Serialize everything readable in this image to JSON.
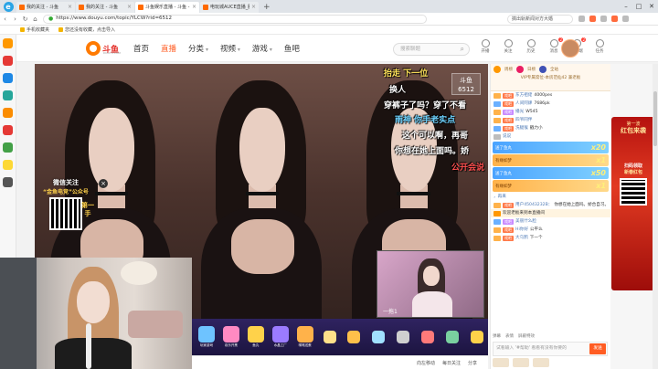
{
  "browser": {
    "tabs": [
      {
        "label": "我的关注 - 斗鱼"
      },
      {
        "label": "我的关注 - 斗鱼"
      },
      {
        "label": "斗鱼娱乐直播 - 斗鱼 - 每个人的直播平台"
      },
      {
        "label": "电玩城AUCE直播_腾讯直播 - 斗鱼"
      }
    ],
    "url": "https://www.douyu.com/topic/YLCW?rid=6512",
    "search_placeholder": "搞出轨新闻对方大婚",
    "bookmarks": [
      "手机收藏夹",
      "您还没有收藏，点击导入"
    ],
    "newtab": "+",
    "win_min": "–",
    "win_max": "□",
    "win_close": "✕"
  },
  "header": {
    "logo_text": "斗鱼",
    "logo_sub": "DOUYU.COM",
    "nav": {
      "home": "首页",
      "live": "直播",
      "category": "分类",
      "video": "视频",
      "game": "游戏",
      "fishbar": "鱼吧"
    },
    "search_placeholder": "搜索聊题",
    "icons": [
      {
        "label": "开播",
        "badge": ""
      },
      {
        "label": "关注",
        "badge": ""
      },
      {
        "label": "历史",
        "badge": ""
      },
      {
        "label": "消息",
        "badge": "2"
      },
      {
        "label": "客户端",
        "badge": "2"
      },
      {
        "label": "任务",
        "badge": ""
      }
    ]
  },
  "stream": {
    "promo": {
      "line1": "微信关注",
      "line2": "“金鱼电竞”公众号",
      "side": "第一手"
    },
    "close_glyph": "×",
    "danmu": [
      {
        "text": "抬走 下一位",
        "color": "#ffe35a"
      },
      {
        "text": "换人",
        "color": "#ffffff"
      },
      {
        "text": "穿裤子了吗？穿了不看",
        "color": "#ffffff"
      },
      {
        "text": "雨神   你手老实点",
        "color": "#6ed3ff"
      },
      {
        "text": "这个可以啊，再哥",
        "color": "#ffffff"
      },
      {
        "text": "你想在她上面吗。娇",
        "color": "#ffffff"
      },
      {
        "text": "公开会说",
        "color": "#ff5050"
      }
    ],
    "room_badge": {
      "line1": "斗鱼",
      "line2": "6512"
    },
    "pip_label": "一拖1"
  },
  "gifts": [
    {
      "label": "玩家游戏"
    },
    {
      "label": "欢乐开黑"
    },
    {
      "label": "鱼丸"
    },
    {
      "label": "水晶工厂"
    },
    {
      "label": "嘴嘴送蛋"
    },
    {
      "label": ""
    },
    {
      "label": ""
    },
    {
      "label": ""
    },
    {
      "label": ""
    },
    {
      "label": ""
    },
    {
      "label": ""
    },
    {
      "label": ""
    }
  ],
  "bottom_strip": {
    "items": [
      "向左移动",
      "每日关注",
      "分享"
    ]
  },
  "chat": {
    "fan_ranks": [
      "周榜",
      "日榜",
      "全站"
    ],
    "vip_line": "VIP专属席位-本房范仙42 兼老板",
    "rows": [
      {
        "fb": "戏吧",
        "name": "东方祖佬",
        "text": "4000pes"
      },
      {
        "fb": "戏吧",
        "name": "人间阿肆",
        "text": "7686pk"
      },
      {
        "fb": "戏吧",
        "name": "播光",
        "text": "W545"
      },
      {
        "fb": "戏吧",
        "name": "四爷同伴",
        "text": ""
      },
      {
        "fb": "戏吧",
        "name": "洗腿猴",
        "text": "戳力小"
      },
      {
        "fb": "",
        "name": "说说",
        "text": ""
      }
    ],
    "banners": [
      {
        "text": "送了鱼丸",
        "num": "x20",
        "style": "blue"
      },
      {
        "text": "有缘如梦",
        "num": "x1",
        "style": "gold"
      },
      {
        "text": "送了鱼丸",
        "num": "x50",
        "style": "blue"
      },
      {
        "text": "有缘如梦",
        "num": "x1",
        "style": "gold"
      }
    ],
    "rows2": [
      {
        "fb": "",
        "name": "，再来",
        "text": ""
      },
      {
        "fb": "戏吧",
        "name": "用户45043232B：",
        "text": "你想在她上面吗。娇合自习。"
      },
      {
        "fb": "",
        "name": "欢迎老板来到本直播间",
        "text": ""
      },
      {
        "fb": "戏吧",
        "name": "美丽什么脸",
        "text": ""
      },
      {
        "fb": "戏吧",
        "name": "Hi你好",
        "text": "公平么"
      },
      {
        "fb": "戏吧",
        "name": "大乌鸦",
        "text": "下一个"
      }
    ],
    "tools": [
      "弹幕",
      "表情",
      "屏蔽特效"
    ],
    "input_placeholder": "试看输入 '#帮助' 看看有没有你要的",
    "send": "发送"
  },
  "ad": {
    "top": "第一波",
    "title": "红包来袭",
    "scan": "扫码领取",
    "bonus": "新春红包"
  }
}
